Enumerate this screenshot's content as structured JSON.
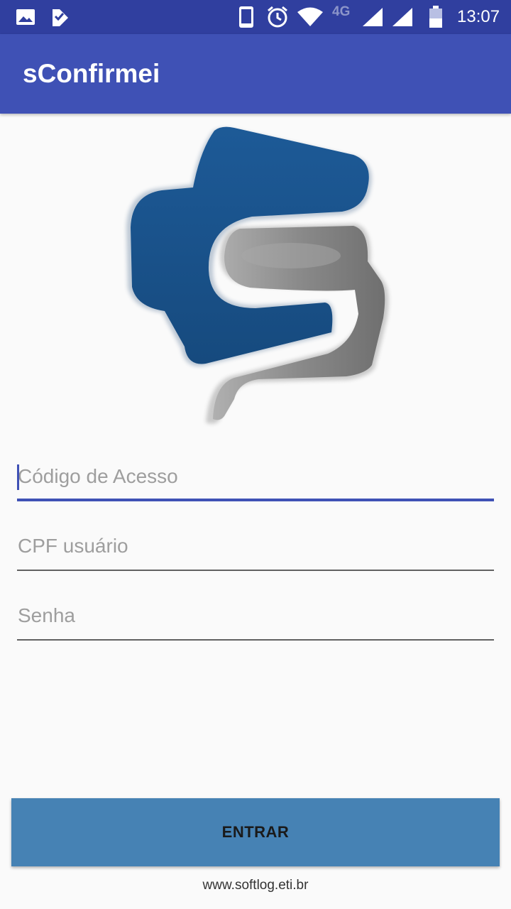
{
  "status_bar": {
    "time": "13:07",
    "network_label": "4G",
    "icons": [
      "image-icon",
      "checklist-icon",
      "phone-vibrate-icon",
      "alarm-icon",
      "wifi-icon",
      "signal-icon",
      "signal-icon",
      "battery-icon"
    ]
  },
  "app_bar": {
    "title": "sConfirmei"
  },
  "logo": {
    "icon": "softlog-logo",
    "colors": {
      "blue": "#1b4f86",
      "gray": "#8e8e8e"
    }
  },
  "form": {
    "access_code": {
      "placeholder": "Código de Acesso",
      "value": ""
    },
    "cpf": {
      "placeholder": "CPF usuário",
      "value": ""
    },
    "password": {
      "placeholder": "Senha",
      "value": ""
    }
  },
  "actions": {
    "login_label": "ENTRAR"
  },
  "footer": {
    "website": "www.softlog.eti.br"
  },
  "colors": {
    "status_bar": "#303f9f",
    "app_bar": "#3f51b5",
    "accent": "#3f51b5",
    "button": "#4682b4",
    "background": "#fafafa"
  }
}
